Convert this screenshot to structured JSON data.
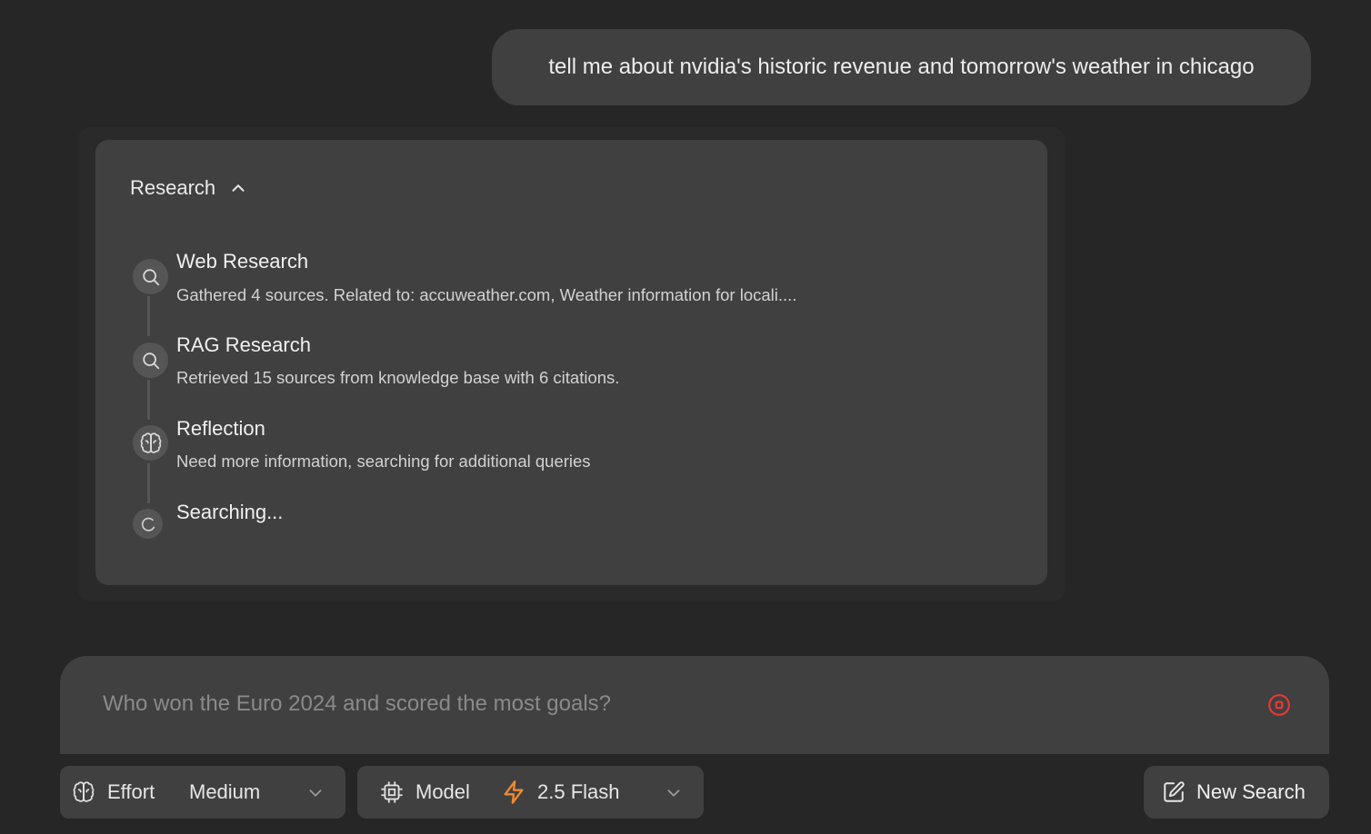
{
  "chat": {
    "user_message": "tell me about nvidia's historic revenue and tomorrow's weather in chicago"
  },
  "research": {
    "header_label": "Research",
    "steps": [
      {
        "title": "Web Research",
        "description": "Gathered 4 sources. Related to: accuweather.com, Weather information for locali....",
        "icon": "search-icon"
      },
      {
        "title": "RAG Research",
        "description": "Retrieved 15 sources from knowledge base with 6 citations.",
        "icon": "search-icon"
      },
      {
        "title": "Reflection",
        "description": "Need more information, searching for additional queries",
        "icon": "brain-icon"
      },
      {
        "title": "Searching...",
        "description": "",
        "icon": "loading-spinner-icon"
      }
    ]
  },
  "input": {
    "placeholder": "Who won the Euro 2024 and scored the most goals?",
    "value": ""
  },
  "controls": {
    "effort": {
      "label": "Effort",
      "value": "Medium",
      "icon": "brain-icon"
    },
    "model": {
      "label": "Model",
      "value": "2.5 Flash",
      "icon": "cpu-icon",
      "value_icon": "lightning-icon",
      "value_icon_color": "#f08a30"
    },
    "new_search_label": "New Search",
    "stop_color": "#e53935"
  }
}
